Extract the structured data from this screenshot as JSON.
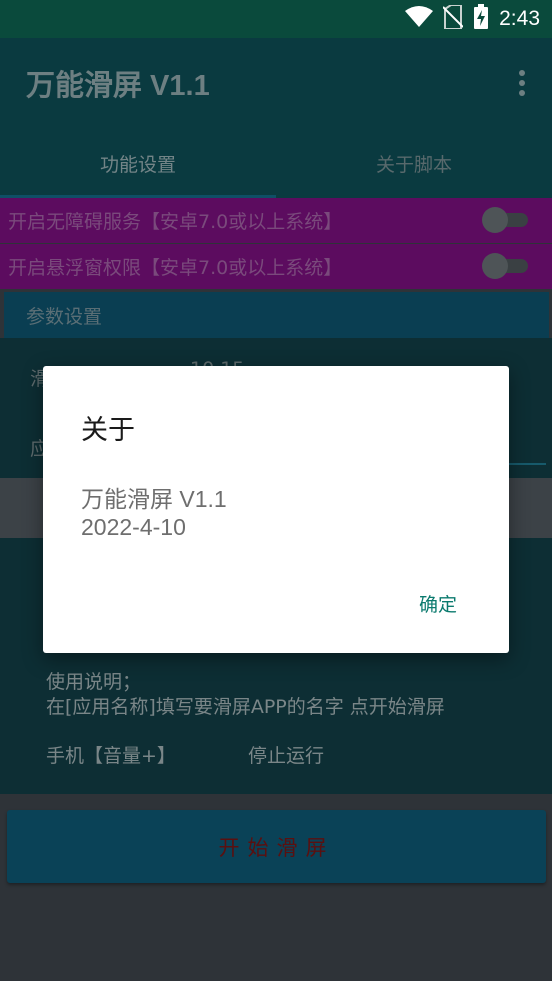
{
  "status_bar": {
    "time": "2:43",
    "icons": [
      "wifi-icon",
      "no-sim-icon",
      "battery-charging-icon"
    ]
  },
  "app": {
    "title": "万能滑屏 V1.1",
    "menu_icon": "more-vert-icon"
  },
  "tabs": [
    {
      "label": "功能设置",
      "active": true
    },
    {
      "label": "关于脚本",
      "active": false
    }
  ],
  "switches": [
    {
      "label": "开启无障碍服务【安卓7.0或以上系统】",
      "on": false
    },
    {
      "label": "开启悬浮窗权限【安卓7.0或以上系统】",
      "on": false
    }
  ],
  "params": {
    "header": "参数设置",
    "row1_label_partial": "滑",
    "row1_values_partial": "10      15",
    "row2_label_partial": "应"
  },
  "instructions": {
    "line1": "使用说明；",
    "line2": "在[应用名称]填写要滑屏APP的名字 点开始滑屏",
    "hotkey": "手机【音量+】",
    "hotkey_action": "停止运行"
  },
  "start_button": "开始滑屏",
  "dialog": {
    "title": "关于",
    "line1": "万能滑屏 V1.1",
    "line2": "2022-4-10",
    "ok_label": "确定"
  },
  "colors": {
    "status_bar": "#0a4a3c",
    "dialog_accent": "#0b7a6e",
    "switch_row": "#5c0c5f"
  }
}
